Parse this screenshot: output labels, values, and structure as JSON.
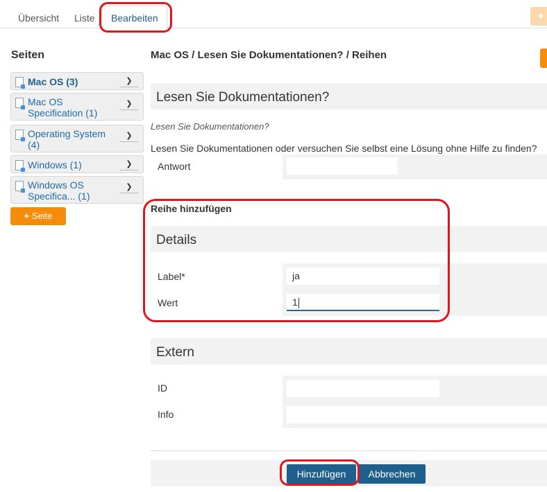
{
  "tabs": [
    {
      "label": "Übersicht"
    },
    {
      "label": "Liste"
    },
    {
      "label": "Bearbeiten"
    }
  ],
  "top_right_button": {
    "label": "+"
  },
  "sidebar": {
    "title": "Seiten",
    "items": [
      {
        "label": "Mac OS (3)"
      },
      {
        "label": "Mac OS Specification (1)"
      },
      {
        "label": "Operating System (4)"
      },
      {
        "label": "Windows (1)"
      },
      {
        "label": "Windows OS Specifica... (1)"
      }
    ],
    "add_button": "Seite"
  },
  "main": {
    "breadcrumb": "Mac OS / Lesen Sie Dokumentationen? / Reihen",
    "question_section": {
      "title": "Lesen Sie Dokumentationen?",
      "italic": "Lesen Sie Dokumentationen?",
      "text": "Lesen Sie Dokumentationen oder versuchen Sie selbst eine Lösung ohne Hilfe zu finden?",
      "answer_label": "Antwort",
      "answer_value": ""
    },
    "add_row_title": "Reihe hinzufügen",
    "details": {
      "title": "Details",
      "label_field": {
        "label": "Label*",
        "value": "ja"
      },
      "value_field": {
        "label": "Wert",
        "value": "1"
      }
    },
    "external": {
      "title": "Extern",
      "id_field": {
        "label": "ID",
        "value": ""
      },
      "info_field": {
        "label": "Info",
        "value": ""
      }
    },
    "buttons": {
      "add": "Hinzufügen",
      "cancel": "Abbrechen"
    }
  }
}
